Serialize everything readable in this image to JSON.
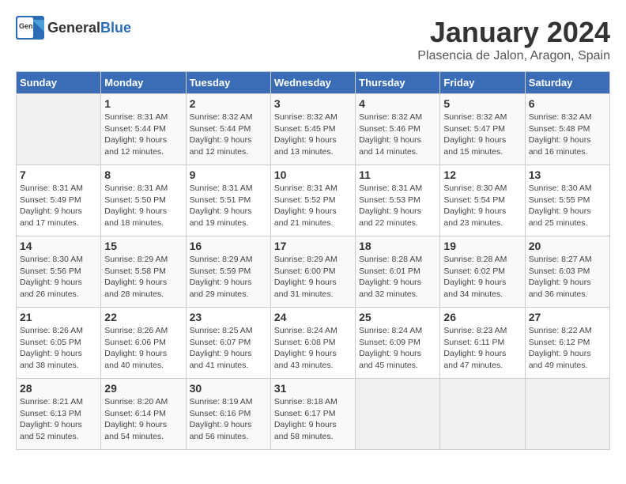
{
  "header": {
    "logo_general": "General",
    "logo_blue": "Blue",
    "month_title": "January 2024",
    "location": "Plasencia de Jalon, Aragon, Spain"
  },
  "days_of_week": [
    "Sunday",
    "Monday",
    "Tuesday",
    "Wednesday",
    "Thursday",
    "Friday",
    "Saturday"
  ],
  "weeks": [
    [
      {
        "day": "",
        "info": ""
      },
      {
        "day": "1",
        "info": "Sunrise: 8:31 AM\nSunset: 5:44 PM\nDaylight: 9 hours\nand 12 minutes."
      },
      {
        "day": "2",
        "info": "Sunrise: 8:32 AM\nSunset: 5:44 PM\nDaylight: 9 hours\nand 12 minutes."
      },
      {
        "day": "3",
        "info": "Sunrise: 8:32 AM\nSunset: 5:45 PM\nDaylight: 9 hours\nand 13 minutes."
      },
      {
        "day": "4",
        "info": "Sunrise: 8:32 AM\nSunset: 5:46 PM\nDaylight: 9 hours\nand 14 minutes."
      },
      {
        "day": "5",
        "info": "Sunrise: 8:32 AM\nSunset: 5:47 PM\nDaylight: 9 hours\nand 15 minutes."
      },
      {
        "day": "6",
        "info": "Sunrise: 8:32 AM\nSunset: 5:48 PM\nDaylight: 9 hours\nand 16 minutes."
      }
    ],
    [
      {
        "day": "7",
        "info": "Sunrise: 8:31 AM\nSunset: 5:49 PM\nDaylight: 9 hours\nand 17 minutes."
      },
      {
        "day": "8",
        "info": "Sunrise: 8:31 AM\nSunset: 5:50 PM\nDaylight: 9 hours\nand 18 minutes."
      },
      {
        "day": "9",
        "info": "Sunrise: 8:31 AM\nSunset: 5:51 PM\nDaylight: 9 hours\nand 19 minutes."
      },
      {
        "day": "10",
        "info": "Sunrise: 8:31 AM\nSunset: 5:52 PM\nDaylight: 9 hours\nand 21 minutes."
      },
      {
        "day": "11",
        "info": "Sunrise: 8:31 AM\nSunset: 5:53 PM\nDaylight: 9 hours\nand 22 minutes."
      },
      {
        "day": "12",
        "info": "Sunrise: 8:30 AM\nSunset: 5:54 PM\nDaylight: 9 hours\nand 23 minutes."
      },
      {
        "day": "13",
        "info": "Sunrise: 8:30 AM\nSunset: 5:55 PM\nDaylight: 9 hours\nand 25 minutes."
      }
    ],
    [
      {
        "day": "14",
        "info": "Sunrise: 8:30 AM\nSunset: 5:56 PM\nDaylight: 9 hours\nand 26 minutes."
      },
      {
        "day": "15",
        "info": "Sunrise: 8:29 AM\nSunset: 5:58 PM\nDaylight: 9 hours\nand 28 minutes."
      },
      {
        "day": "16",
        "info": "Sunrise: 8:29 AM\nSunset: 5:59 PM\nDaylight: 9 hours\nand 29 minutes."
      },
      {
        "day": "17",
        "info": "Sunrise: 8:29 AM\nSunset: 6:00 PM\nDaylight: 9 hours\nand 31 minutes."
      },
      {
        "day": "18",
        "info": "Sunrise: 8:28 AM\nSunset: 6:01 PM\nDaylight: 9 hours\nand 32 minutes."
      },
      {
        "day": "19",
        "info": "Sunrise: 8:28 AM\nSunset: 6:02 PM\nDaylight: 9 hours\nand 34 minutes."
      },
      {
        "day": "20",
        "info": "Sunrise: 8:27 AM\nSunset: 6:03 PM\nDaylight: 9 hours\nand 36 minutes."
      }
    ],
    [
      {
        "day": "21",
        "info": "Sunrise: 8:26 AM\nSunset: 6:05 PM\nDaylight: 9 hours\nand 38 minutes."
      },
      {
        "day": "22",
        "info": "Sunrise: 8:26 AM\nSunset: 6:06 PM\nDaylight: 9 hours\nand 40 minutes."
      },
      {
        "day": "23",
        "info": "Sunrise: 8:25 AM\nSunset: 6:07 PM\nDaylight: 9 hours\nand 41 minutes."
      },
      {
        "day": "24",
        "info": "Sunrise: 8:24 AM\nSunset: 6:08 PM\nDaylight: 9 hours\nand 43 minutes."
      },
      {
        "day": "25",
        "info": "Sunrise: 8:24 AM\nSunset: 6:09 PM\nDaylight: 9 hours\nand 45 minutes."
      },
      {
        "day": "26",
        "info": "Sunrise: 8:23 AM\nSunset: 6:11 PM\nDaylight: 9 hours\nand 47 minutes."
      },
      {
        "day": "27",
        "info": "Sunrise: 8:22 AM\nSunset: 6:12 PM\nDaylight: 9 hours\nand 49 minutes."
      }
    ],
    [
      {
        "day": "28",
        "info": "Sunrise: 8:21 AM\nSunset: 6:13 PM\nDaylight: 9 hours\nand 52 minutes."
      },
      {
        "day": "29",
        "info": "Sunrise: 8:20 AM\nSunset: 6:14 PM\nDaylight: 9 hours\nand 54 minutes."
      },
      {
        "day": "30",
        "info": "Sunrise: 8:19 AM\nSunset: 6:16 PM\nDaylight: 9 hours\nand 56 minutes."
      },
      {
        "day": "31",
        "info": "Sunrise: 8:18 AM\nSunset: 6:17 PM\nDaylight: 9 hours\nand 58 minutes."
      },
      {
        "day": "",
        "info": ""
      },
      {
        "day": "",
        "info": ""
      },
      {
        "day": "",
        "info": ""
      }
    ]
  ]
}
